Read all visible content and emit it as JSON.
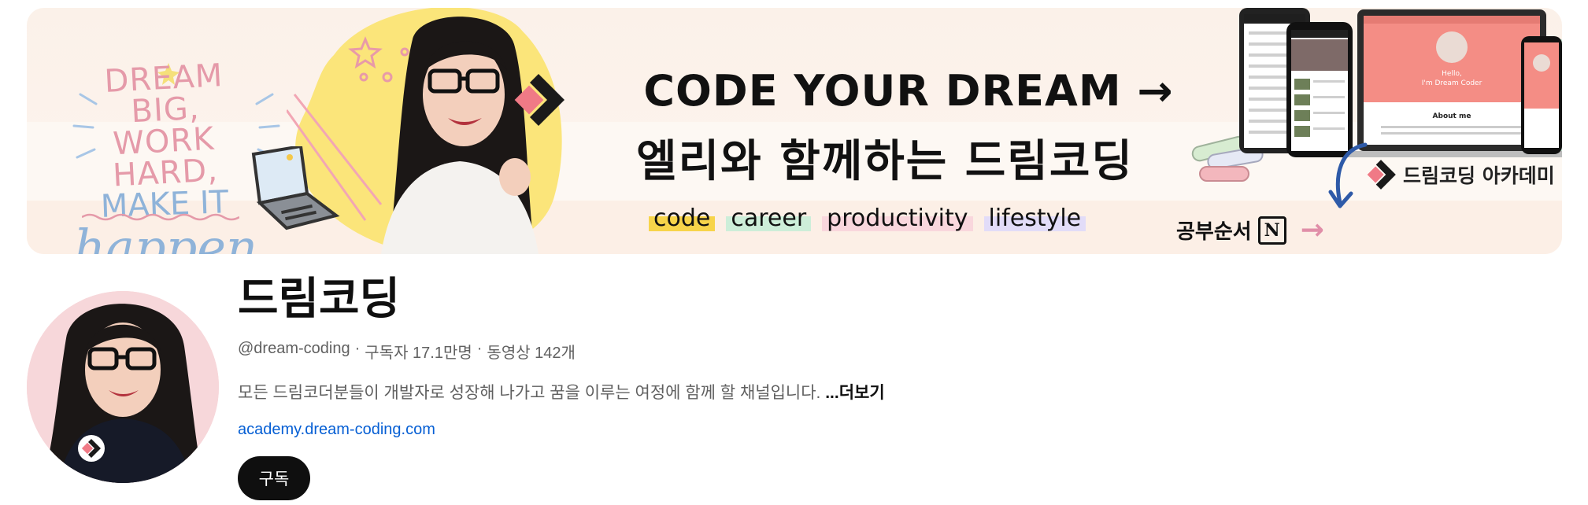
{
  "banner": {
    "motivation": {
      "line1": "DREAM BIG,",
      "line2": "WORK HARD,",
      "line3": "MAKE IT",
      "line4": "happen."
    },
    "headline": "CODE YOUR DREAM →",
    "subheadline": "엘리와 함께하는 드림코딩",
    "tags": [
      "code",
      "career",
      "productivity",
      "lifestyle"
    ],
    "study_order": "공부순서",
    "notion_letter": "N",
    "study_arrow": "→",
    "academy_label": "드림코딩 아카데미",
    "device_screen": {
      "hello": "Hello,",
      "coder": "I'm Dream Coder",
      "about": "About me"
    }
  },
  "channel": {
    "name": "드림코딩",
    "handle": "@dream-coding",
    "subscribers": "구독자 17.1만명",
    "videos": "동영상 142개",
    "separator": "·",
    "description": "모든 드림코더분들이 개발자로 성장해 나가고 꿈을 이루는 여정에 함께 할 채널입니다. ",
    "more_label": "...더보기",
    "link": "academy.dream-coding.com",
    "subscribe_label": "구독"
  },
  "colors": {
    "banner_bg": "#fbf1e9",
    "blob_yellow": "#fbe57a",
    "logo_red": "#e85d6b",
    "link_blue": "#065fd4",
    "subscribe_bg": "#0f0f0f"
  }
}
